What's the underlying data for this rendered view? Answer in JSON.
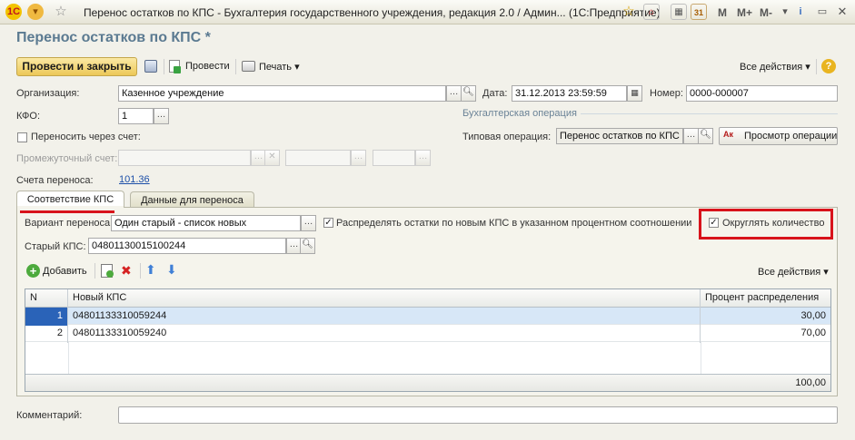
{
  "window": {
    "title": "Перенос остатков по КПС - Бухгалтерия государственного учреждения, редакция 2.0 / Админ...  (1С:Предприятие)",
    "app_logo": "1С",
    "toolbar_icons": [
      "star-icon",
      "home-icon",
      "calculator-icon",
      "calendar-icon"
    ],
    "mem_buttons": [
      "M",
      "M+",
      "M-"
    ]
  },
  "form": {
    "title": "Перенос остатков по КПС *"
  },
  "toolbar": {
    "post_close": "Провести и закрыть",
    "post": "Провести",
    "print": "Печать",
    "all_actions": "Все действия",
    "help": "?"
  },
  "fields": {
    "org_label": "Организация:",
    "org_value": "Казенное учреждение",
    "date_label": "Дата:",
    "date_value": "31.12.2013 23:59:59",
    "number_label": "Номер:",
    "number_value": "0000-000007",
    "kfo_label": "КФО:",
    "kfo_value": "1",
    "via_account_label": "Переносить через счет:",
    "intermediate_label": "Промежуточный счет:",
    "accounts_label": "Счета переноса:",
    "accounts_value": "101.36"
  },
  "operation": {
    "group_title": "Бухгалтерская операция",
    "type_label": "Типовая операция:",
    "type_value": "Перенос остатков по КПС",
    "view_button": "Просмотр операции"
  },
  "tabs": [
    {
      "label": "Соответствие КПС"
    },
    {
      "label": "Данные для переноса"
    }
  ],
  "tab1": {
    "variant_label": "Вариант переноса:",
    "variant_value": "Один старый - список новых",
    "distribute_label": "Распределять остатки по новым КПС в указанном процентном соотношении",
    "distribute_checked": true,
    "round_label": "Округлять количество",
    "round_checked": true,
    "old_kps_label": "Старый КПС:",
    "old_kps_value": "04801130015100244",
    "add_button": "Добавить",
    "all_actions": "Все действия"
  },
  "table": {
    "columns": [
      "N",
      "Новый КПС",
      "Процент распределения"
    ],
    "rows": [
      {
        "n": "1",
        "kps": "04801133310059244",
        "pct": "30,00"
      },
      {
        "n": "2",
        "kps": "04801133310059240",
        "pct": "70,00"
      }
    ],
    "total": "100,00"
  },
  "comment": {
    "label": "Комментарий:"
  },
  "colors": {
    "accent": "#5b7a91",
    "highlight": "#d8131b",
    "primary_button": "#ecc858"
  }
}
